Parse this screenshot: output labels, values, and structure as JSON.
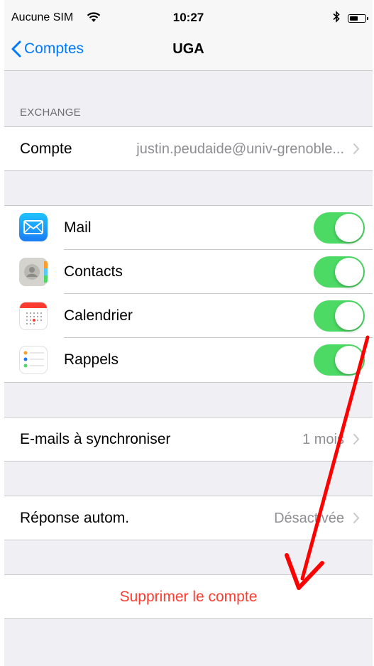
{
  "status_bar": {
    "carrier": "Aucune SIM",
    "time": "10:27"
  },
  "nav": {
    "back_label": "Comptes",
    "title": "UGA"
  },
  "exchange_section": {
    "header": "EXCHANGE",
    "account_label": "Compte",
    "account_value": "justin.peudaide@univ-grenoble..."
  },
  "services": [
    {
      "label": "Mail",
      "icon": "mail-icon",
      "enabled": true
    },
    {
      "label": "Contacts",
      "icon": "contacts-icon",
      "enabled": true
    },
    {
      "label": "Calendrier",
      "icon": "calendar-icon",
      "enabled": true
    },
    {
      "label": "Rappels",
      "icon": "reminders-icon",
      "enabled": true
    }
  ],
  "sync": {
    "label": "E-mails à synchroniser",
    "value": "1 mois"
  },
  "auto_reply": {
    "label": "Réponse autom.",
    "value": "Désactivée"
  },
  "delete_account": {
    "label": "Supprimer le compte"
  },
  "colors": {
    "accent": "#007aff",
    "toggle_on": "#4cd964",
    "destructive": "#ff3b30",
    "annotation_arrow": "#ff0000"
  }
}
